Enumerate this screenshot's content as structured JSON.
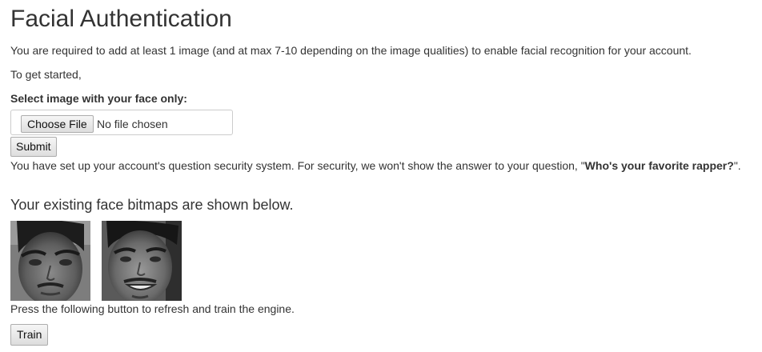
{
  "page": {
    "title": "Facial Authentication",
    "intro": "You are required to add at least 1 image (and at max 7-10 depending on the image qualities) to enable facial recognition for your account.",
    "get_started": "To get started,"
  },
  "upload": {
    "label": "Select image with your face only:",
    "choose_button": "Choose File",
    "file_status": "No file chosen",
    "submit_button": "Submit"
  },
  "security": {
    "text_before": "You have set up your account's question security system. For security, we won't show the answer to your question, \"",
    "question": "Who's your favorite rapper?",
    "text_after": "\"."
  },
  "bitmaps": {
    "heading": "Your existing face bitmaps are shown below.",
    "images": [
      {
        "icon": "grayscale-face-photo"
      },
      {
        "icon": "grayscale-face-photo-smiling"
      }
    ]
  },
  "train": {
    "instruction": "Press the following button to refresh and train the engine.",
    "button": "Train"
  }
}
